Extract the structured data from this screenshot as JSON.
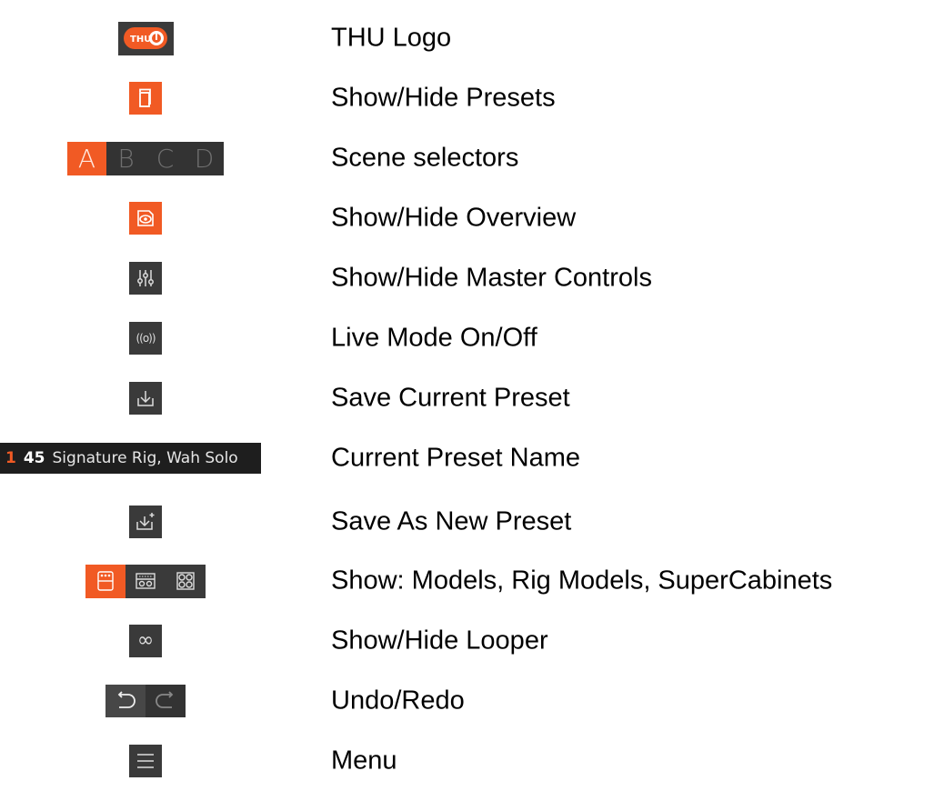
{
  "legend": {
    "rows": [
      {
        "id": "logo",
        "label": "THU Logo",
        "logo_text": "THU"
      },
      {
        "id": "presets",
        "label": "Show/Hide Presets"
      },
      {
        "id": "scenes",
        "label": "Scene selectors"
      },
      {
        "id": "overview",
        "label": "Show/Hide Overview"
      },
      {
        "id": "master",
        "label": "Show/Hide Master Controls"
      },
      {
        "id": "live",
        "label": "Live Mode On/Off",
        "icon_text": "((o))"
      },
      {
        "id": "save",
        "label": "Save Current Preset"
      },
      {
        "id": "preset_name",
        "label": "Current Preset Name"
      },
      {
        "id": "save_as",
        "label": "Save As New Preset"
      },
      {
        "id": "views",
        "label": "Show: Models, Rig Models, SuperCabinets"
      },
      {
        "id": "looper",
        "label": "Show/Hide Looper",
        "icon_text": "∞"
      },
      {
        "id": "undo_redo",
        "label": "Undo/Redo"
      },
      {
        "id": "menu",
        "label": "Menu"
      }
    ]
  },
  "scenes": {
    "items": [
      "A",
      "B",
      "C",
      "D"
    ],
    "active": "A"
  },
  "preset": {
    "bank": "1",
    "number": "45",
    "name": "Signature Rig, Wah Solo"
  },
  "colors": {
    "accent": "#f15a24",
    "button_bg": "#3a3a3a",
    "preset_bg": "#1e1e1e"
  }
}
